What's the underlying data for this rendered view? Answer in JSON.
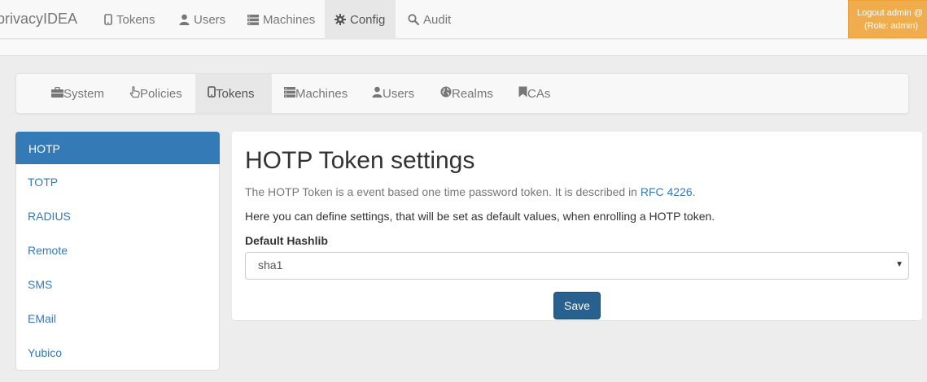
{
  "topnav": {
    "brand": "privacyIDEA",
    "items": [
      {
        "label": "Tokens",
        "icon": "phone-icon"
      },
      {
        "label": "Users",
        "icon": "user-icon"
      },
      {
        "label": "Machines",
        "icon": "server-icon"
      },
      {
        "label": "Config",
        "icon": "gear-icon",
        "active": true
      },
      {
        "label": "Audit",
        "icon": "search-icon"
      }
    ],
    "logout_line1": "Logout admin @",
    "logout_line2": "(Role: admin)"
  },
  "subnav": {
    "items": [
      {
        "label": "System",
        "icon": "briefcase-icon"
      },
      {
        "label": "Policies",
        "icon": "hand-icon"
      },
      {
        "label": "Tokens",
        "icon": "phone-icon",
        "active": true
      },
      {
        "label": "Machines",
        "icon": "server-icon"
      },
      {
        "label": "Users",
        "icon": "user-icon"
      },
      {
        "label": "Realms",
        "icon": "globe-icon"
      },
      {
        "label": "CAs",
        "icon": "bookmark-icon"
      }
    ]
  },
  "sidebar": {
    "items": [
      {
        "label": "HOTP",
        "active": true
      },
      {
        "label": "TOTP"
      },
      {
        "label": "RADIUS"
      },
      {
        "label": "Remote"
      },
      {
        "label": "SMS"
      },
      {
        "label": "EMail"
      },
      {
        "label": "Yubico"
      }
    ]
  },
  "main": {
    "title": "HOTP Token settings",
    "description": "The HOTP Token is a event based one time password token. It is described in ",
    "rfc_link": "RFC 4226",
    "description_end": ".",
    "info": "Here you can define settings, that will be set as default values, when enrolling a HOTP token.",
    "hashlib_label": "Default Hashlib",
    "hashlib_value": "sha1",
    "save_label": "Save"
  },
  "colors": {
    "primary": "#337ab7",
    "save": "#286090",
    "logout": "#f0ad4e"
  }
}
